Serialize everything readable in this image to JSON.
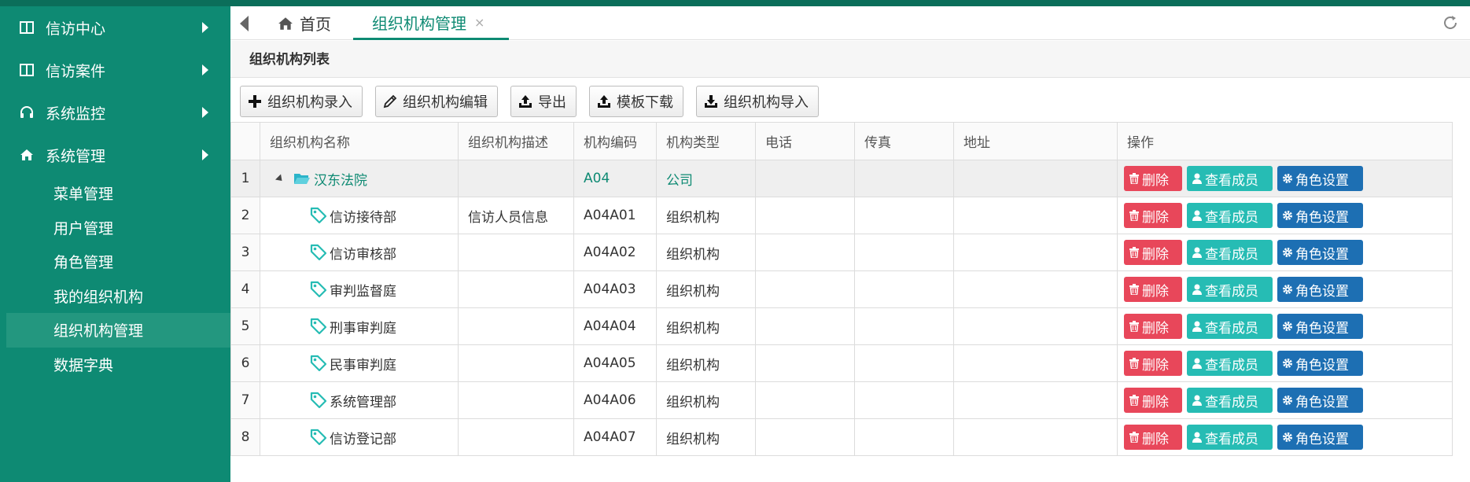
{
  "sidebar": {
    "groups": [
      {
        "label": "信访中心",
        "icon": "columns-icon"
      },
      {
        "label": "信访案件",
        "icon": "columns-icon"
      },
      {
        "label": "系统监控",
        "icon": "headset-icon"
      },
      {
        "label": "系统管理",
        "icon": "home-icon"
      }
    ],
    "subitems": [
      {
        "label": "菜单管理"
      },
      {
        "label": "用户管理"
      },
      {
        "label": "角色管理"
      },
      {
        "label": "我的组织机构"
      },
      {
        "label": "组织机构管理",
        "active": true
      },
      {
        "label": "数据字典"
      }
    ]
  },
  "tabs": {
    "home": "首页",
    "org": "组织机构管理",
    "close": "×"
  },
  "panel": {
    "title": "组织机构列表"
  },
  "toolbar": {
    "add": "组织机构录入",
    "edit": "组织机构编辑",
    "export": "导出",
    "template": "模板下载",
    "import": "组织机构导入"
  },
  "table": {
    "columns": [
      "组织机构名称",
      "组织机构描述",
      "机构编码",
      "机构类型",
      "电话",
      "传真",
      "地址",
      "操作"
    ],
    "actions": {
      "delete": "删除",
      "view": "查看成员",
      "role": "角色设置"
    },
    "rows": [
      {
        "no": "1",
        "name": "汉东法院",
        "desc": "",
        "code": "A04",
        "type": "公司",
        "phone": "",
        "fax": "",
        "addr": ""
      },
      {
        "no": "2",
        "name": "信访接待部",
        "desc": "信访人员信息",
        "code": "A04A01",
        "type": "组织机构",
        "phone": "",
        "fax": "",
        "addr": ""
      },
      {
        "no": "3",
        "name": "信访审核部",
        "desc": "",
        "code": "A04A02",
        "type": "组织机构",
        "phone": "",
        "fax": "",
        "addr": ""
      },
      {
        "no": "4",
        "name": "审判监督庭",
        "desc": "",
        "code": "A04A03",
        "type": "组织机构",
        "phone": "",
        "fax": "",
        "addr": ""
      },
      {
        "no": "5",
        "name": "刑事审判庭",
        "desc": "",
        "code": "A04A04",
        "type": "组织机构",
        "phone": "",
        "fax": "",
        "addr": ""
      },
      {
        "no": "6",
        "name": "民事审判庭",
        "desc": "",
        "code": "A04A05",
        "type": "组织机构",
        "phone": "",
        "fax": "",
        "addr": ""
      },
      {
        "no": "7",
        "name": "系统管理部",
        "desc": "",
        "code": "A04A06",
        "type": "组织机构",
        "phone": "",
        "fax": "",
        "addr": ""
      },
      {
        "no": "8",
        "name": "信访登记部",
        "desc": "",
        "code": "A04A07",
        "type": "组织机构",
        "phone": "",
        "fax": "",
        "addr": ""
      }
    ]
  },
  "colors": {
    "sidebar": "#0e8a73",
    "accent": "#0e8a73",
    "delete": "#e8475a",
    "view": "#26bcb4",
    "role": "#1d6fb3"
  }
}
